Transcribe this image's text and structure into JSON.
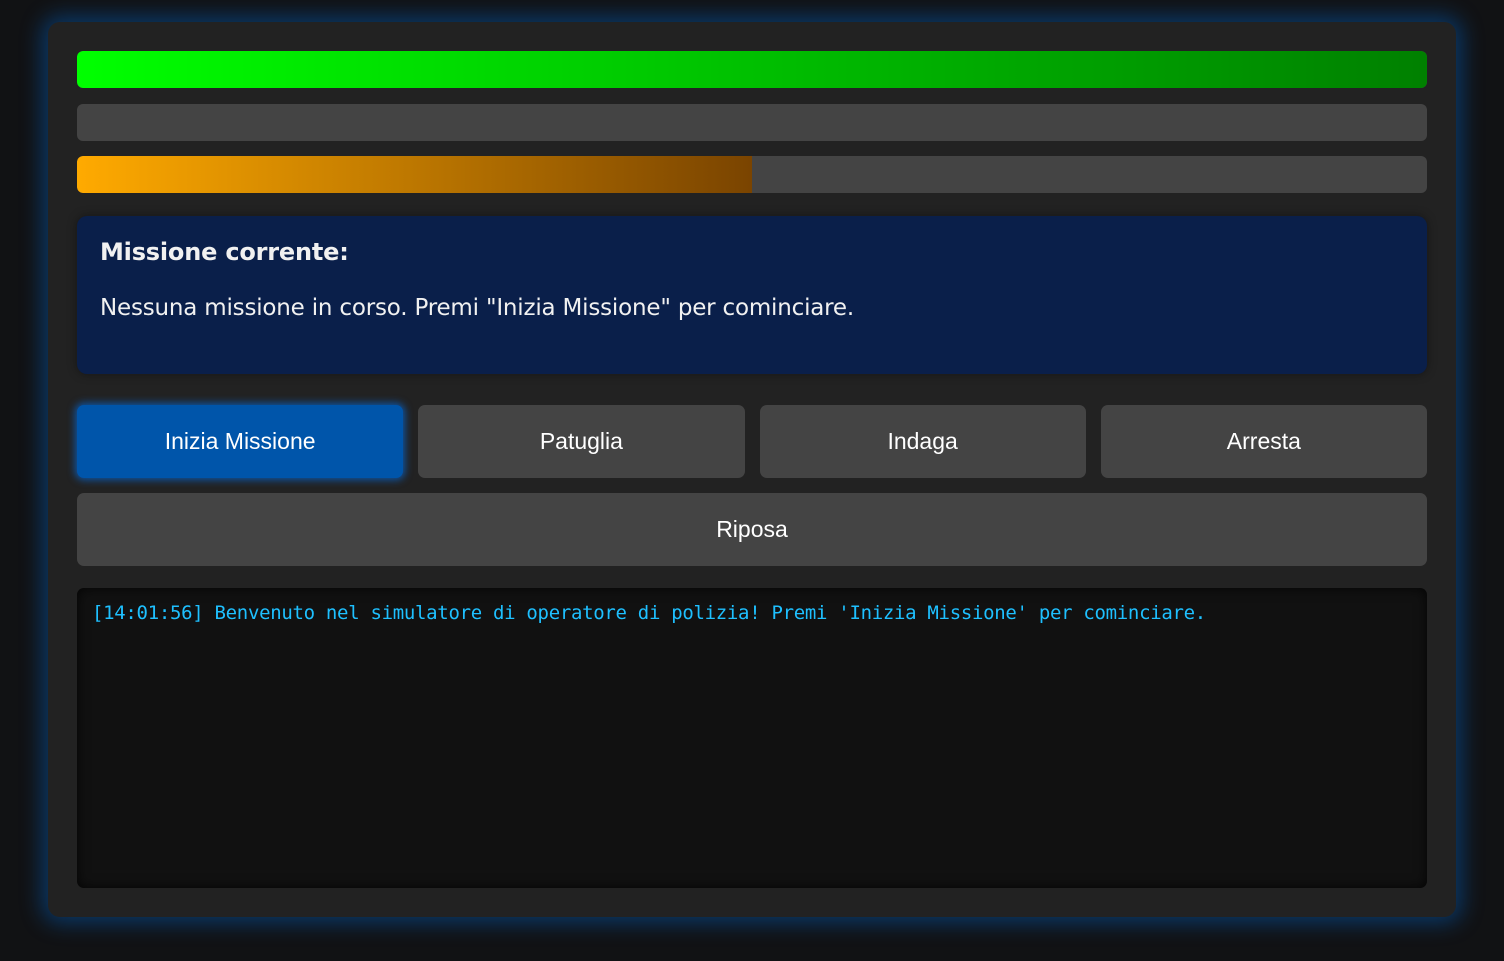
{
  "status_bars": [
    {
      "fill_fraction": 1.0,
      "color_start": "#00ff00",
      "color_end": "#008000"
    },
    {
      "fill_fraction": 0.0,
      "color_start": "#1e90ff",
      "color_end": "#003f7f"
    },
    {
      "fill_fraction": 0.5,
      "color_start": "#ffaa00",
      "color_end": "#7a4400"
    }
  ],
  "mission": {
    "title": "Missione corrente:",
    "text": "Nessuna missione in corso. Premi \"Inizia Missione\" per cominciare."
  },
  "actions": {
    "start_label": "Inizia Missione",
    "patrol_label": "Patuglia",
    "investigate_label": "Indaga",
    "arrest_label": "Arresta",
    "rest_label": "Riposa"
  },
  "log": {
    "entries": [
      "[14:01:56] Benvenuto nel simulatore di operatore di polizia! Premi 'Inizia Missione' per cominciare."
    ]
  },
  "colors": {
    "accent": "#0055aa",
    "panel": "#0a1f4a",
    "log_text": "#1ec0ff"
  }
}
